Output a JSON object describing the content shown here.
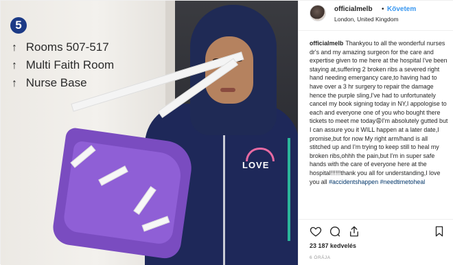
{
  "photo": {
    "sign": {
      "number": "5",
      "rows": [
        {
          "arrow": "↑",
          "label": "Rooms 507-517"
        },
        {
          "arrow": "↑",
          "label": "Multi Faith Room"
        },
        {
          "arrow": "↑",
          "label": "Nurse Base"
        }
      ]
    },
    "shirt_text": "LOVE"
  },
  "header": {
    "username": "officialmelb",
    "separator": "•",
    "follow_label": "Követem",
    "location": "London, United Kingdom"
  },
  "caption": {
    "username": "officialmelb",
    "body": "Thankyou to all the wonderful nurses dr's and my amazing surgeon for the care and expertise given to me here at the hospital I've been staying at,suffering 2 broken ribs a severed right hand needing emergancy care,to having had to have over a 3 hr surgery to repair the damage hence the purple sling,I've had to unfortunately cancel my book signing today in NY,I appologise to each and everyone one of you who bought there tickets to meet me today😩I'm absolutely gutted but I can assure you it WILL happen at a later date,I promise,but for now My right arm/hand is all stitched up and I'm trying to keep still to heal my broken ribs,ohhh the pain,but I'm in super safe hands with the care of everyone here at the hospital!!!!!!thank you all for understanding,I love you all",
    "hashtags": "#accidentshappen #needtimetoheal"
  },
  "actions": {
    "like_icon": "heart-icon",
    "comment_icon": "comment-icon",
    "share_icon": "share-icon",
    "save_icon": "bookmark-icon"
  },
  "likes": "23 187 kedvelés",
  "timestamp": "6 ÓRÁJA",
  "colors": {
    "follow": "#3897f0",
    "hashtag": "#003569",
    "sign_badge": "#1c3a86",
    "sling": "#8f5fd6",
    "hoodie": "#1e2859"
  }
}
